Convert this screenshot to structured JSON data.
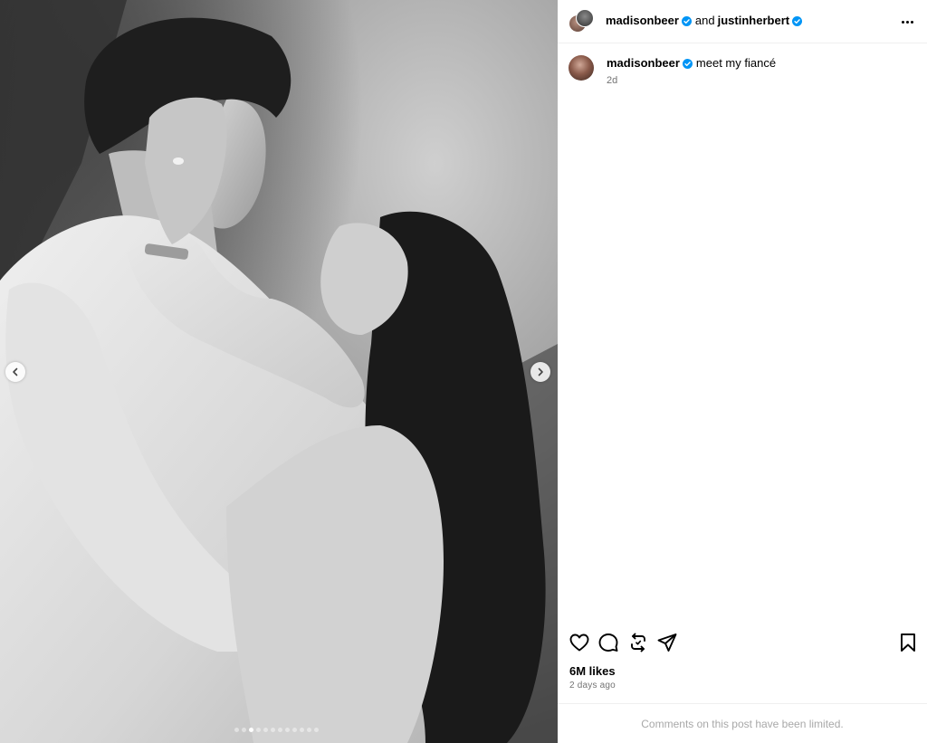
{
  "post": {
    "media": {
      "description_icon": "photo",
      "carousel_total": 12,
      "carousel_active_index": 2
    },
    "header": {
      "author": "madisonbeer",
      "conjunction": "and",
      "collaborator": "justinherbert"
    },
    "caption": {
      "username": "madisonbeer",
      "text": "meet my fiancé",
      "time": "2d"
    },
    "likes": "6M likes",
    "posted": "2 days ago",
    "comments_notice": "Comments on this post have been limited.",
    "colors": {
      "verified": "#0095f6",
      "meta_text": "#737373",
      "notice_text": "#a8a8a8"
    },
    "icons": [
      "verified-badge-icon",
      "more-options-icon",
      "heart-icon",
      "comment-icon",
      "repost-icon",
      "share-icon",
      "bookmark-icon",
      "chevron-left-icon",
      "chevron-right-icon"
    ]
  }
}
